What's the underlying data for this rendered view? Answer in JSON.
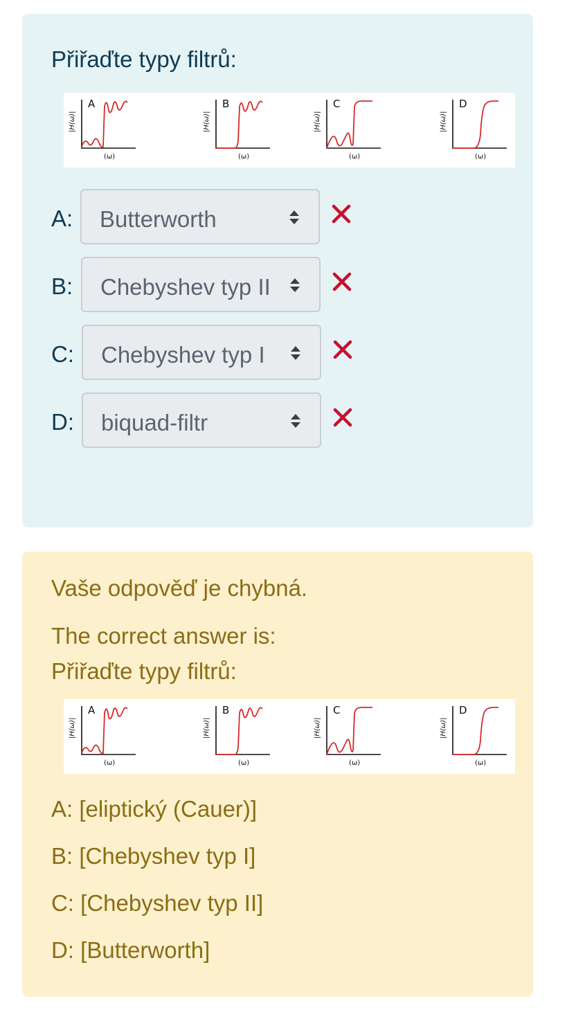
{
  "question": {
    "prompt": "Přiřaďte typy filtrů:",
    "figure": {
      "y_axis_label": "|H(ω)|",
      "x_axis_label": "(ω)",
      "panels": [
        "A",
        "B",
        "C",
        "D"
      ],
      "curve_color": "#d42b2b"
    },
    "rows": [
      {
        "label": "A:",
        "selected": "Butterworth",
        "status_icon": "cross-icon"
      },
      {
        "label": "B:",
        "selected": "Chebyshev typ II",
        "status_icon": "cross-icon"
      },
      {
        "label": "C:",
        "selected": "Chebyshev typ I",
        "status_icon": "cross-icon"
      },
      {
        "label": "D:",
        "selected": "biquad-filtr",
        "status_icon": "cross-icon"
      }
    ]
  },
  "feedback": {
    "verdict": "Vaše odpověď je chybná.",
    "correct_intro": "The correct answer is:",
    "prompt": "Přiřaďte typy filtrů:",
    "answers": [
      "A: [eliptický (Cauer)]",
      "B: [Chebyshev typ I]",
      "C: [Chebyshev typ II]",
      "D: [Butterworth]"
    ]
  },
  "colors": {
    "question_bg": "#e6f3f5",
    "feedback_bg": "#fdf0cd",
    "error": "#c8102e",
    "text_dark": "#0d3b54",
    "feedback_text": "#8a6d16"
  }
}
